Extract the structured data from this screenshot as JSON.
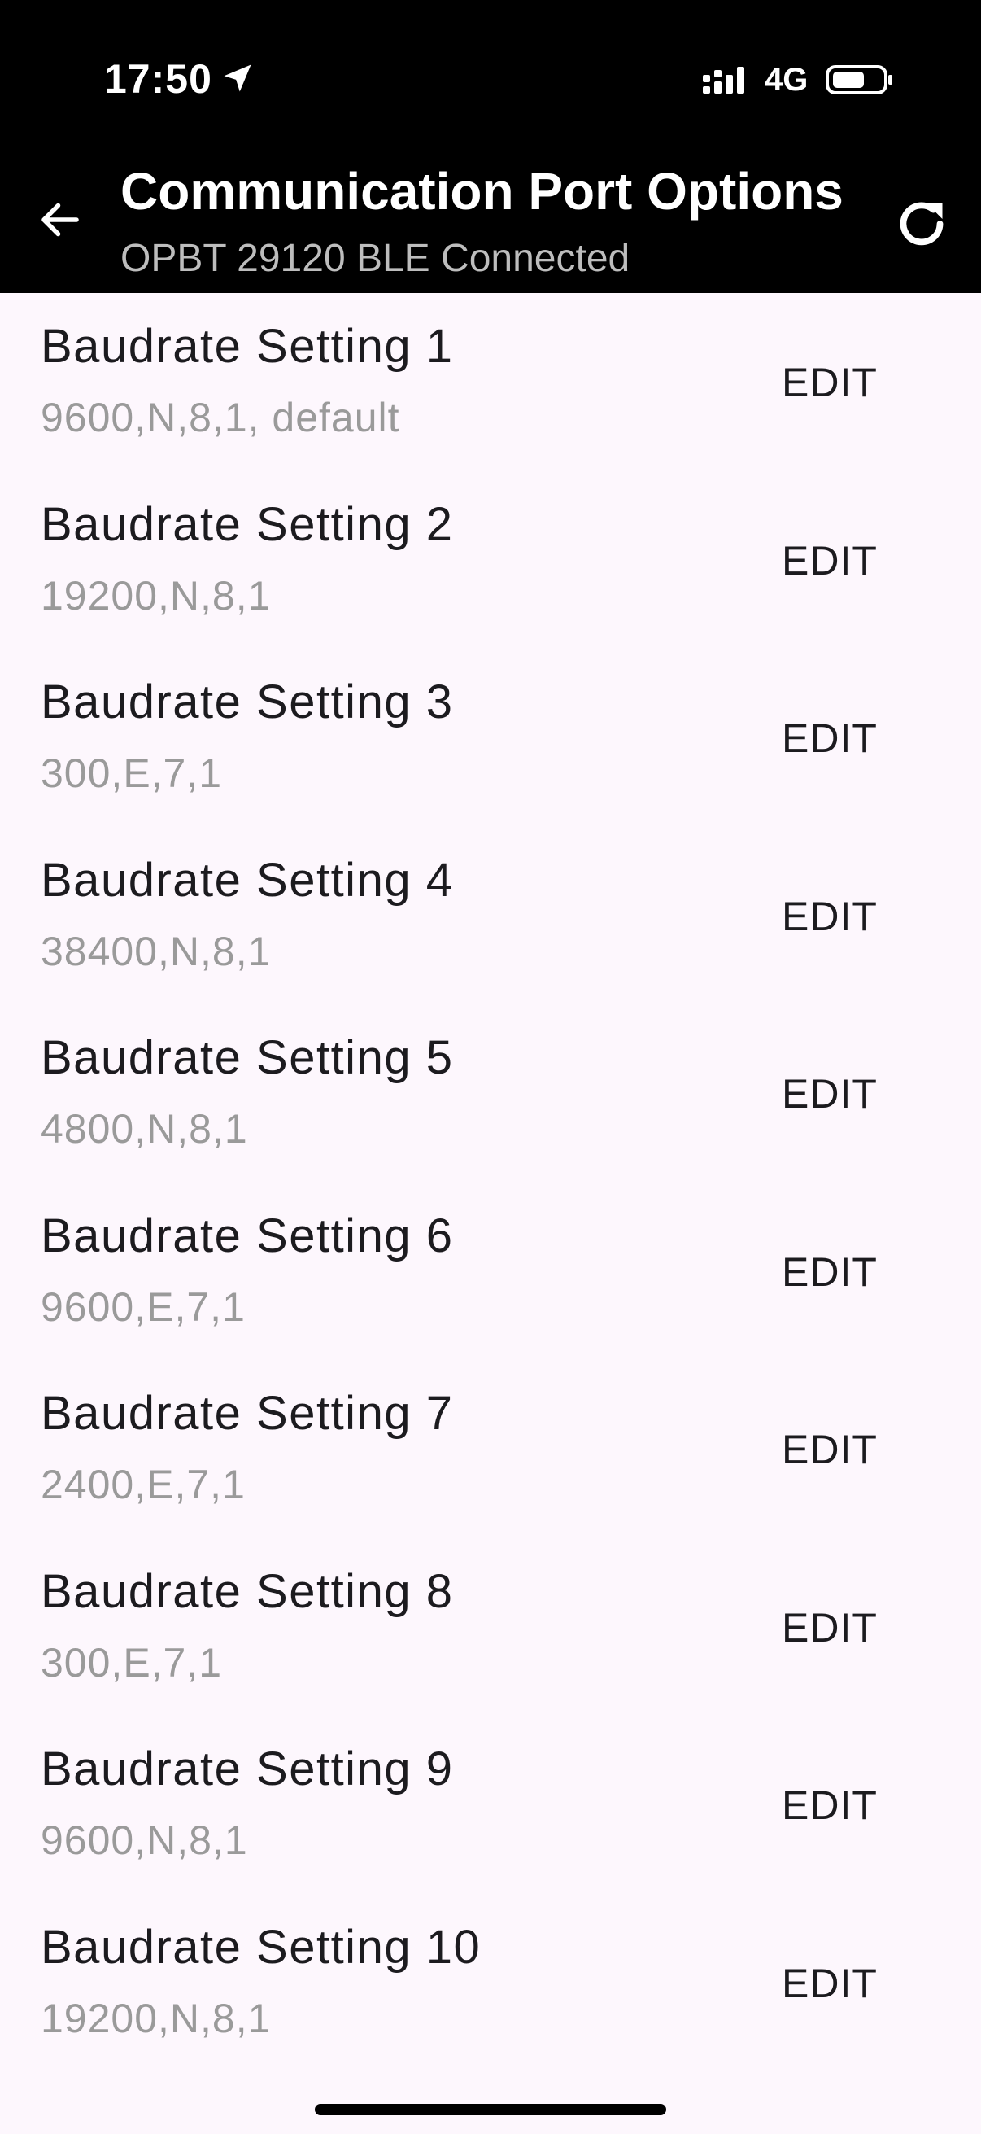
{
  "status_bar": {
    "time": "17:50",
    "network": "4G",
    "location_icon": "location-arrow-icon",
    "signal_icon": "cellular-signal-icon",
    "battery_icon": "battery-icon"
  },
  "app_bar": {
    "title": "Communication Port Options",
    "subtitle": "OPBT 29120 BLE Connected",
    "back_icon": "arrow-left-icon",
    "refresh_icon": "refresh-icon"
  },
  "settings": [
    {
      "label": "Baudrate Setting 1",
      "value": "9600,N,8,1, default",
      "action": "EDIT"
    },
    {
      "label": "Baudrate Setting 2",
      "value": "19200,N,8,1",
      "action": "EDIT"
    },
    {
      "label": "Baudrate Setting 3",
      "value": "300,E,7,1",
      "action": "EDIT"
    },
    {
      "label": "Baudrate Setting 4",
      "value": "38400,N,8,1",
      "action": "EDIT"
    },
    {
      "label": "Baudrate Setting 5",
      "value": "4800,N,8,1",
      "action": "EDIT"
    },
    {
      "label": "Baudrate Setting 6",
      "value": "9600,E,7,1",
      "action": "EDIT"
    },
    {
      "label": "Baudrate Setting 7",
      "value": "2400,E,7,1",
      "action": "EDIT"
    },
    {
      "label": "Baudrate Setting 8",
      "value": "300,E,7,1",
      "action": "EDIT"
    },
    {
      "label": "Baudrate Setting 9",
      "value": "9600,N,8,1",
      "action": "EDIT"
    },
    {
      "label": "Baudrate Setting 10",
      "value": "19200,N,8,1",
      "action": "EDIT"
    }
  ],
  "colors": {
    "header_background": "#000000",
    "list_background": "#fdf7fd",
    "primary_text": "#1c1b1f",
    "secondary_text": "#9a9a9a"
  }
}
